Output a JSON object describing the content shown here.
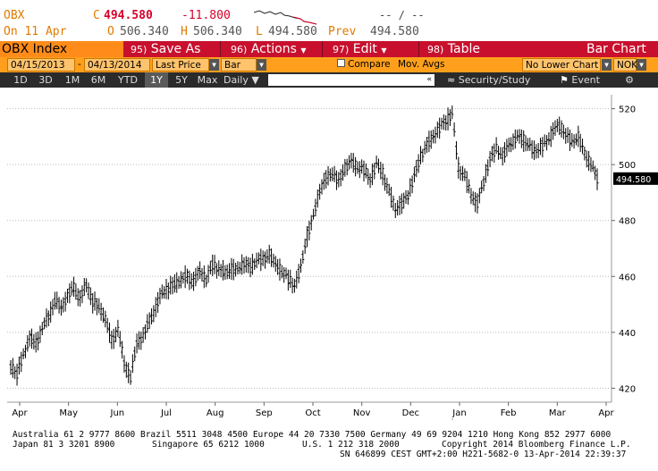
{
  "quote": {
    "ticker": "OBX",
    "last_prefix": "C",
    "last": "494.580",
    "change": "-11.800",
    "date_label": "On 11 Apr",
    "open_label": "O",
    "open": "506.340",
    "high_label": "H",
    "high": "506.340",
    "low_label": "L",
    "low": "494.580",
    "prev_label": "Prev",
    "prev": "494.580",
    "placeholder": "-- / --"
  },
  "toolbar": {
    "security": "OBX Index",
    "save_num": "95)",
    "save_label": "Save As",
    "actions_num": "96)",
    "actions_label": "Actions",
    "edit_num": "97)",
    "edit_label": "Edit",
    "table_num": "98)",
    "table_label": "Table",
    "chart_type": "Bar Chart"
  },
  "params": {
    "start_date": "04/15/2013",
    "dash": "-",
    "end_date": "04/13/2014",
    "field": "Last Price",
    "style": "Bar",
    "compare": "Compare",
    "mov_avgs": "Mov. Avgs",
    "lower_chart": "No Lower Chart",
    "currency": "NOK"
  },
  "range": {
    "buttons": [
      "1D",
      "3D",
      "1M",
      "6M",
      "YTD",
      "1Y",
      "5Y",
      "Max"
    ],
    "active": "1Y",
    "period": "Daily",
    "input_arrow": "«",
    "security_study": "Security/Study",
    "event": "Event"
  },
  "chart_data": {
    "type": "ohlc-bar",
    "ylim": [
      415,
      525
    ],
    "y_ticks": [
      420,
      440,
      460,
      480,
      500,
      520
    ],
    "x_months": [
      "Apr",
      "May",
      "Jun",
      "Jul",
      "Aug",
      "Sep",
      "Oct",
      "Nov",
      "Dec",
      "Jan",
      "Feb",
      "Mar",
      "Apr"
    ],
    "years": [
      "2013",
      "2014"
    ],
    "last_value_label": "494.580",
    "color": "#000000",
    "closes": [
      428,
      425,
      432,
      438,
      436,
      441,
      446,
      451,
      449,
      453,
      456,
      452,
      457,
      451,
      449,
      445,
      437,
      441,
      429,
      424,
      436,
      439,
      444,
      449,
      454,
      456,
      457,
      459,
      460,
      458,
      462,
      459,
      464,
      463,
      461,
      463,
      462,
      465,
      463,
      466,
      466,
      468,
      464,
      462,
      459,
      457,
      463,
      475,
      481,
      491,
      495,
      497,
      494,
      499,
      501,
      499,
      498,
      495,
      500,
      497,
      490,
      484,
      486,
      489,
      496,
      503,
      507,
      510,
      513,
      516,
      518,
      499,
      496,
      489,
      486,
      494,
      502,
      506,
      503,
      507,
      509,
      510,
      507,
      505,
      506,
      508,
      512,
      514,
      511,
      508,
      510,
      504,
      500,
      495
    ]
  },
  "footer": {
    "line1": "Australia 61 2 9777 8600 Brazil 5511 3048 4500 Europe 44 20 7330 7500 Germany 49 69 9204 1210 Hong Kong 852 2977 6000",
    "line2a": "Japan 81 3 3201 8900",
    "line2b": "Singapore 65 6212 1000",
    "line2c": "U.S. 1 212 318 2000",
    "line2d": "Copyright 2014 Bloomberg Finance L.P.",
    "line3": "SN 646899 CEST GMT+2:00 H221-5682-0 13-Apr-2014 22:39:37"
  }
}
